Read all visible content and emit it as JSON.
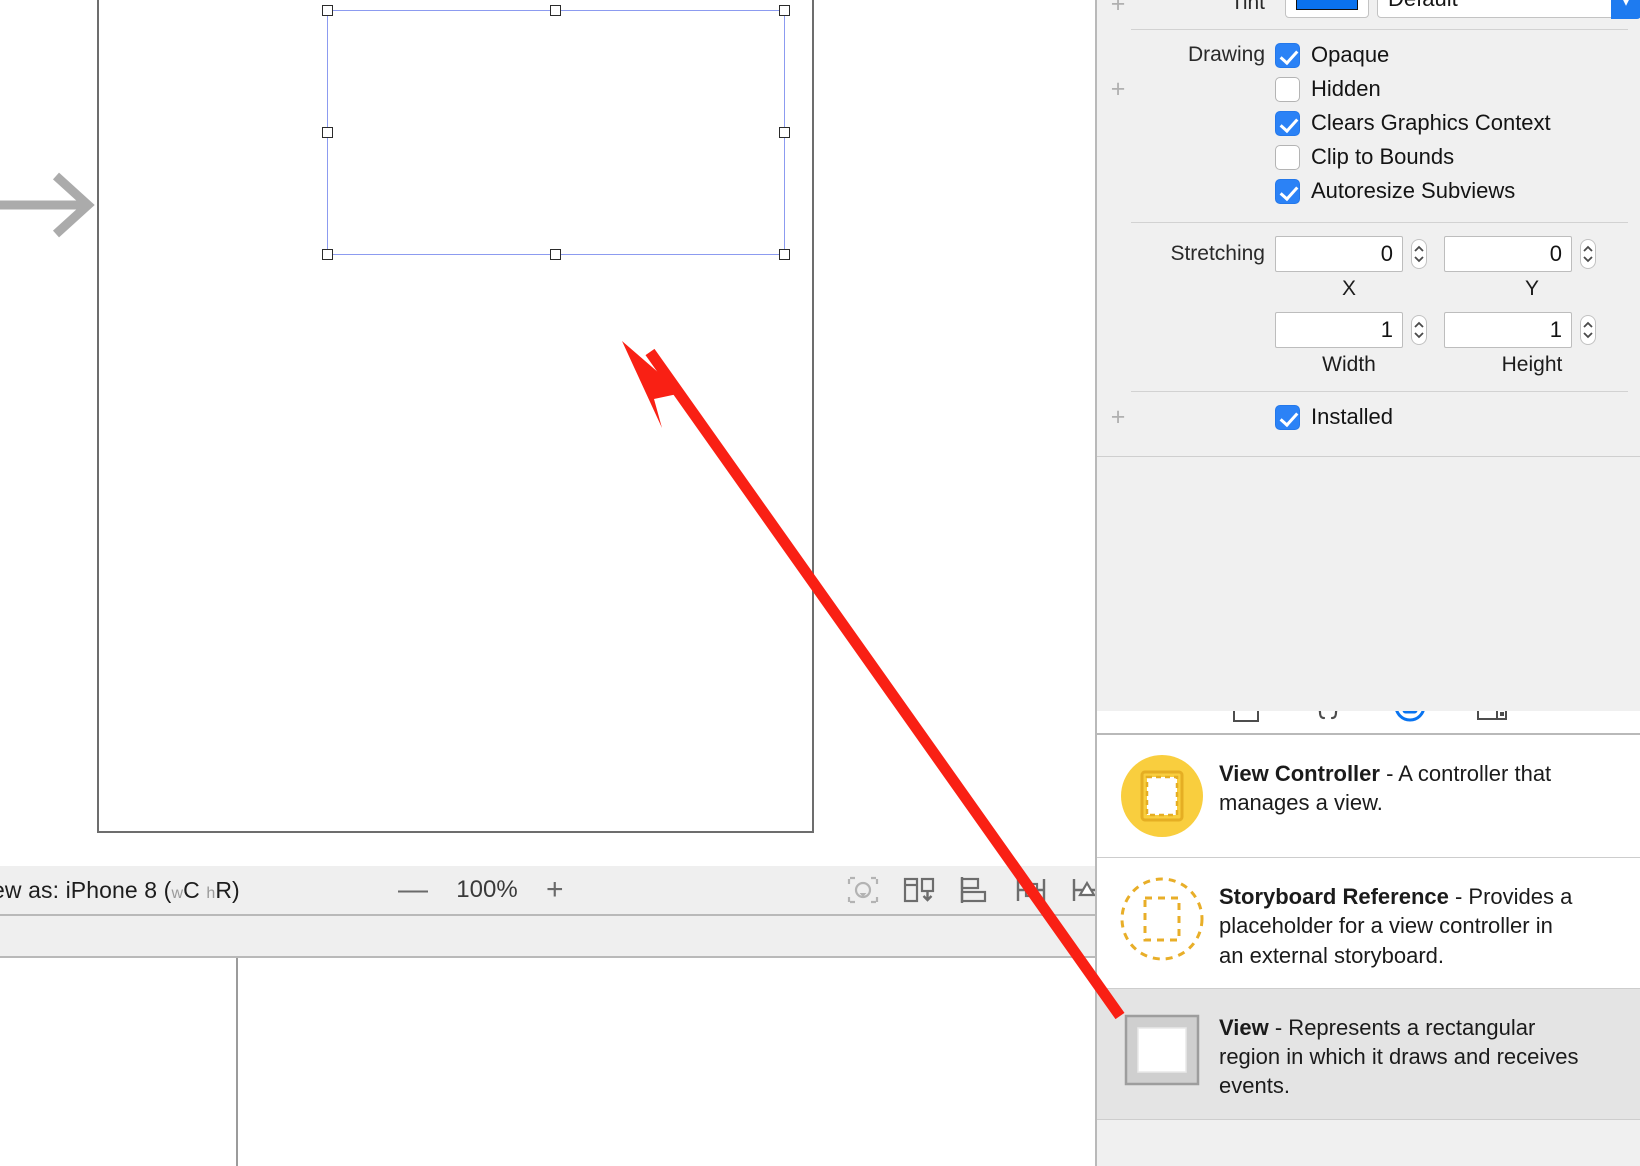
{
  "canvas": {
    "entry_arrow_icon": "entry-point-arrow",
    "device_name": "iPhone 8",
    "selected_element": "View"
  },
  "toolbar": {
    "view_as_prefix": "ew as: ",
    "view_as_device": "iPhone 8",
    "size_class_open": " (",
    "size_class_w_sub": "w",
    "size_class_w": "C",
    "size_class_h_sub": "h",
    "size_class_h": "R",
    "size_class_close": ")",
    "zoom_out_label": "—",
    "zoom_level": "100%",
    "zoom_in_label": "+",
    "tools": [
      {
        "name": "update-frames-icon",
        "title": "Update Frames"
      },
      {
        "name": "embed-in-icon",
        "title": "Embed In"
      },
      {
        "name": "align-icon",
        "title": "Align"
      },
      {
        "name": "add-constraints-icon",
        "title": "Add New Constraints"
      },
      {
        "name": "resolve-issues-icon",
        "title": "Resolve Auto Layout Issues"
      }
    ]
  },
  "inspector": {
    "tint": {
      "label": "Tint",
      "swatch_color": "#0a72ee",
      "value": "Default"
    },
    "drawing": {
      "label": "Drawing",
      "options": [
        {
          "label": "Opaque",
          "checked": true
        },
        {
          "label": "Hidden",
          "checked": false
        },
        {
          "label": "Clears Graphics Context",
          "checked": true
        },
        {
          "label": "Clip to Bounds",
          "checked": false
        },
        {
          "label": "Autoresize Subviews",
          "checked": true
        }
      ]
    },
    "stretching": {
      "label": "Stretching",
      "fields": [
        {
          "caption": "X",
          "value": "0"
        },
        {
          "caption": "Y",
          "value": "0"
        },
        {
          "caption": "Width",
          "value": "1"
        },
        {
          "caption": "Height",
          "value": "1"
        }
      ]
    },
    "installed": {
      "label": "Installed",
      "checked": true
    }
  },
  "library": {
    "tabs": [
      {
        "name": "file-template-library-icon",
        "selected": false
      },
      {
        "name": "code-snippet-library-icon",
        "selected": false
      },
      {
        "name": "object-library-icon",
        "selected": true
      },
      {
        "name": "media-library-icon",
        "selected": false
      }
    ],
    "items": [
      {
        "title": "View Controller",
        "description": " - A controller that manages a view.",
        "icon": "view-controller-icon",
        "selected": false
      },
      {
        "title": "Storyboard Reference",
        "description": " - Provides a placeholder for a view controller in an external storyboard.",
        "icon": "storyboard-reference-icon",
        "selected": false
      },
      {
        "title": "View",
        "description": " - Represents a rectangular region in which it draws and receives events.",
        "icon": "view-icon",
        "selected": true
      }
    ]
  },
  "annotation": {
    "arrow_color": "#f92014",
    "name": "red-pointer-arrow"
  }
}
